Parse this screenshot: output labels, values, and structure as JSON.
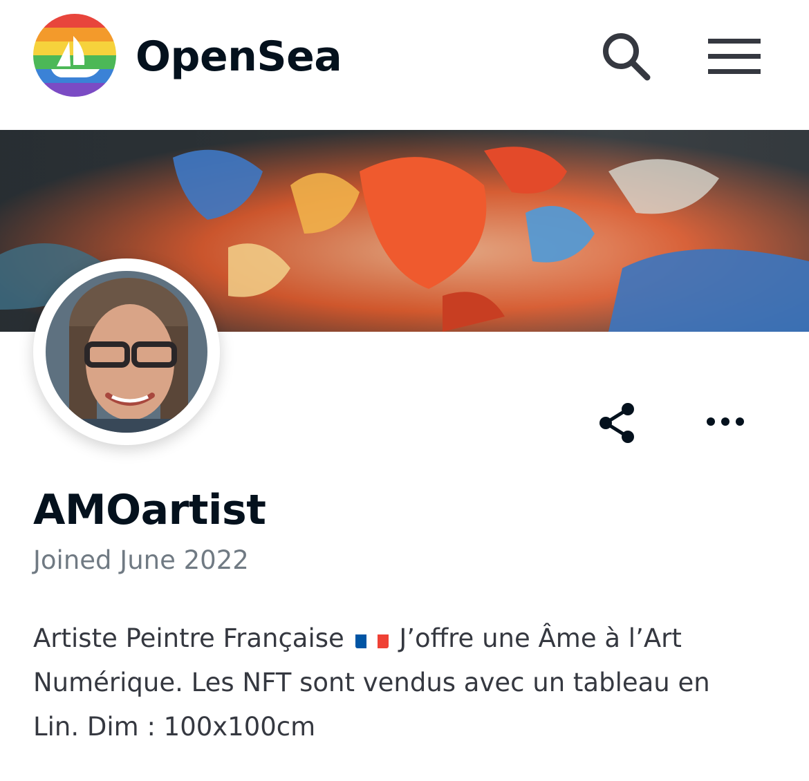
{
  "header": {
    "brand": "OpenSea",
    "logo_icon": "opensea-pride-logo-icon",
    "search_icon": "search-icon",
    "menu_icon": "hamburger-menu-icon"
  },
  "profile": {
    "banner": "abstract painting banner",
    "avatar": "profile avatar photo",
    "username": "AMOartist",
    "joined": "Joined June 2022",
    "bio_part1": "Artiste Peintre Française",
    "bio_part2": "J’offre une Âme à l’Art Numérique. Les NFT sont vendus avec un tableau en Lin. Dim : 100x100cm",
    "actions": {
      "share_icon": "share-icon",
      "more_icon": "more-options-icon"
    }
  },
  "colors": {
    "text_primary": "#04111d",
    "text_secondary": "#707a83",
    "text_body": "#353840",
    "flag_blue": "#0055a4",
    "flag_white": "#ffffff",
    "flag_red": "#ef4135"
  }
}
